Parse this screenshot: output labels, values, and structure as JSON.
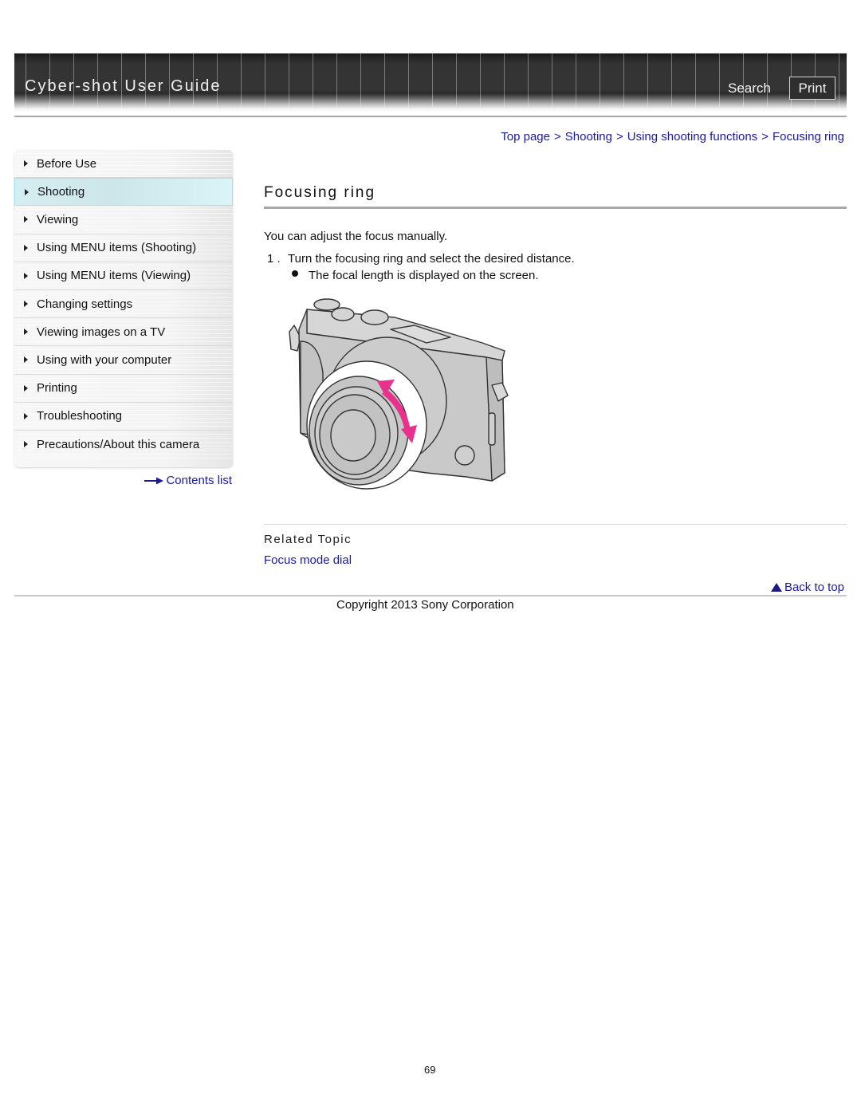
{
  "header": {
    "title": "Cyber-shot User Guide",
    "search_label": "Search",
    "print_label": "Print"
  },
  "breadcrumb": {
    "items": [
      "Top page",
      "Shooting",
      "Using shooting functions",
      "Focusing ring"
    ],
    "separator": ">"
  },
  "sidebar": {
    "items": [
      {
        "label": "Before Use",
        "active": false
      },
      {
        "label": "Shooting",
        "active": true
      },
      {
        "label": "Viewing",
        "active": false
      },
      {
        "label": "Using MENU items (Shooting)",
        "active": false
      },
      {
        "label": "Using MENU items (Viewing)",
        "active": false
      },
      {
        "label": "Changing settings",
        "active": false
      },
      {
        "label": "Viewing images on a TV",
        "active": false
      },
      {
        "label": "Using with your computer",
        "active": false
      },
      {
        "label": "Printing",
        "active": false
      },
      {
        "label": "Troubleshooting",
        "active": false
      },
      {
        "label": "Precautions/About this camera",
        "active": false
      }
    ],
    "contents_list_label": "Contents list"
  },
  "main": {
    "title": "Focusing ring",
    "intro": "You can adjust the focus manually.",
    "steps": [
      {
        "number": "1 .",
        "text": "Turn the focusing ring and select the desired distance.",
        "bullets": [
          "The focal length is displayed on the screen."
        ]
      }
    ],
    "figure": {
      "description": "camera-focusing-ring-illustration",
      "arrow_color": "#e8308c"
    },
    "related_heading": "Related Topic",
    "related_links": [
      "Focus mode dial"
    ]
  },
  "footer": {
    "back_to_top_label": "Back to top",
    "copyright": "Copyright 2013 Sony Corporation",
    "page_number": "69"
  },
  "colors": {
    "link": "#1a1aa6",
    "header_bg": "#333333",
    "active_item_bg": "#d6eef2",
    "active_item_border": "#9fe3ef"
  }
}
